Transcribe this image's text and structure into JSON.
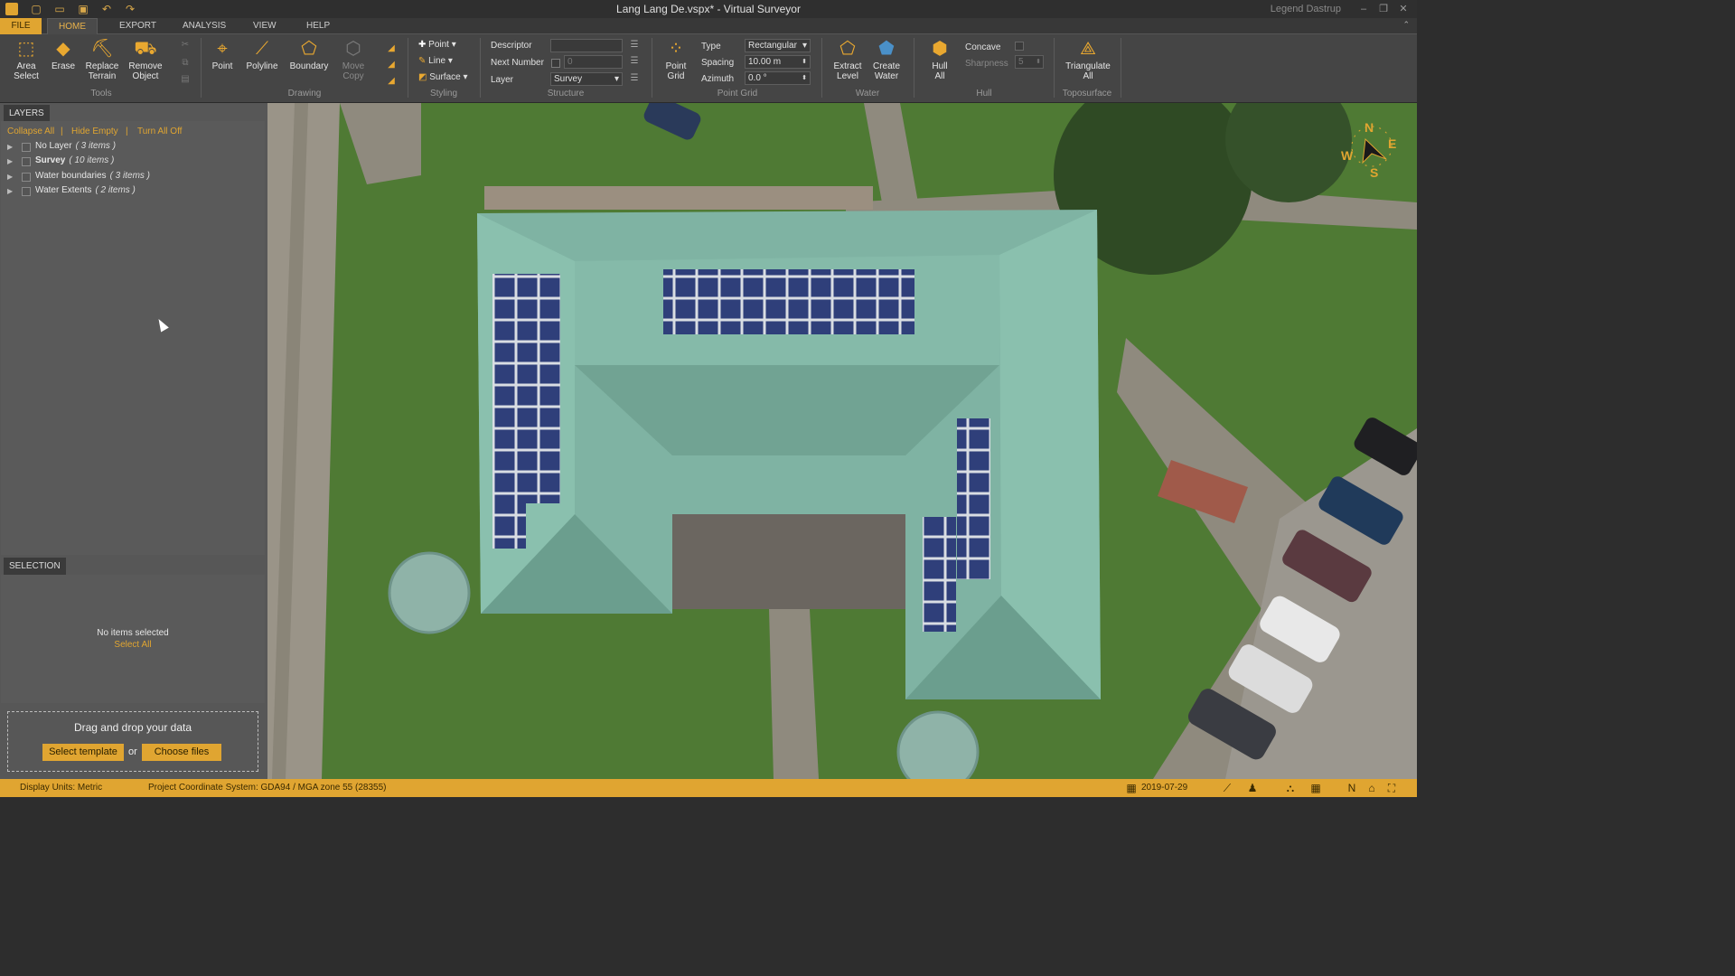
{
  "titlebar": {
    "title": "Lang Lang De.vspx*  -  Virtual Surveyor",
    "user": "Legend Dastrup"
  },
  "menu": {
    "file": "FILE",
    "home": "HOME",
    "export": "EXPORT",
    "analysis": "ANALYSIS",
    "view": "VIEW",
    "help": "HELP"
  },
  "ribbon": {
    "tools": {
      "area_select": [
        "Area",
        "Select"
      ],
      "erase": "Erase",
      "replace_terrain": [
        "Replace",
        "Terrain"
      ],
      "remove_object": [
        "Remove",
        "Object"
      ],
      "label": "Tools"
    },
    "drawing": {
      "point": "Point",
      "polyline": "Polyline",
      "boundary": "Boundary",
      "move_copy": [
        "Move",
        "Copy"
      ],
      "label": "Drawing"
    },
    "styling": {
      "point": "Point",
      "line": "Line",
      "surface": "Surface",
      "label": "Styling"
    },
    "structure": {
      "descriptor_label": "Descriptor",
      "descriptor_value": "",
      "next_number_label": "Next Number",
      "next_number_value": "0",
      "layer_label": "Layer",
      "layer_value": "Survey",
      "label": "Structure"
    },
    "point_grid": {
      "button": [
        "Point",
        "Grid"
      ],
      "type_label": "Type",
      "type_value": "Rectangular",
      "spacing_label": "Spacing",
      "spacing_value": "10.00 m",
      "azimuth_label": "Azimuth",
      "azimuth_value": "0.0 °",
      "label": "Point Grid"
    },
    "water": {
      "extract_level": [
        "Extract",
        "Level"
      ],
      "create_water": [
        "Create",
        "Water"
      ],
      "label": "Water"
    },
    "hull": {
      "hull_all": [
        "Hull",
        "All"
      ],
      "concave_label": "Concave",
      "sharpness_label": "Sharpness",
      "sharpness_value": "5",
      "label": "Hull"
    },
    "toposurface": {
      "triangulate_all": [
        "Triangulate",
        "All"
      ],
      "label": "Toposurface"
    }
  },
  "layers_panel": {
    "tab": "LAYERS",
    "links": {
      "collapse_all": "Collapse All",
      "hide_empty": "Hide Empty",
      "turn_all_off": "Turn All Off",
      "sep": "|"
    },
    "items": [
      {
        "name": "No Layer",
        "count": "( 3 items )",
        "bold": false
      },
      {
        "name": "Survey",
        "count": "( 10 items )",
        "bold": true
      },
      {
        "name": "Water boundaries",
        "count": "( 3 items )",
        "bold": false
      },
      {
        "name": "Water Extents",
        "count": "( 2 items )",
        "bold": false
      }
    ]
  },
  "selection_panel": {
    "tab": "SELECTION",
    "empty": "No items selected",
    "select_all": "Select All"
  },
  "drop_zone": {
    "title": "Drag and drop your data",
    "select_template": "Select template",
    "or": "or",
    "choose_files": "Choose files"
  },
  "compass": {
    "n": "N",
    "e": "E",
    "s": "S",
    "w": "W"
  },
  "statusbar": {
    "display_units": "Display Units:  Metric",
    "crs": "Project Coordinate System:   GDA94 / MGA zone 55 (28355)",
    "date": "2019-07-29"
  },
  "colors": {
    "accent": "#e0a531",
    "ribbon_bg": "#454545",
    "panel_bg": "#575757",
    "roof": "#7fb3a3",
    "grass": "#4f7a34"
  }
}
